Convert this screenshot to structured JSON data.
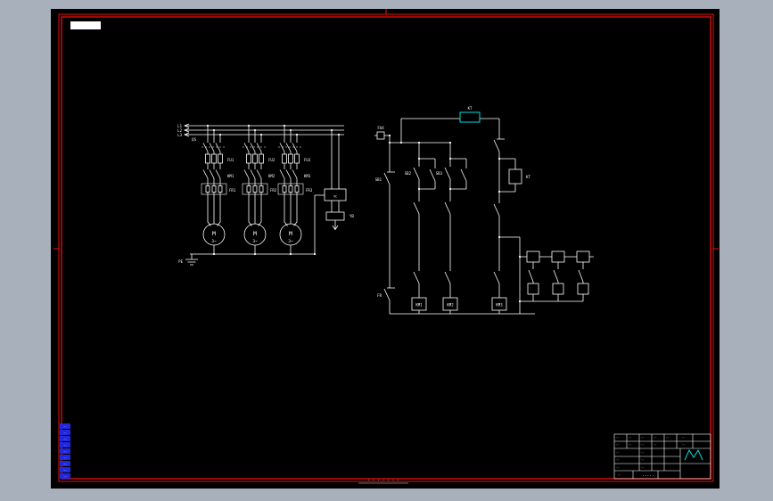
{
  "window": {
    "background": "#a7b0bb",
    "canvas": "#000000",
    "frame_color": "#e81010",
    "line_color": "#ffffff",
    "highlight_color": "#00dcdc",
    "margin_table_color": "#2228dd",
    "doc_text_color": "#5577ff"
  },
  "schematic": {
    "power": {
      "phase_labels": [
        "L1",
        "L2",
        "L3"
      ],
      "switch_label": "QS",
      "groups": [
        {
          "fuse": "FU1",
          "contactor": "KM1",
          "overload": "FR1",
          "motor": "M",
          "motor_type": "3~"
        },
        {
          "fuse": "FU2",
          "contactor": "KM2",
          "overload": "FR2",
          "motor": "M",
          "motor_type": "3~"
        },
        {
          "fuse": "FU3",
          "contactor": "KM3",
          "overload": "FR3",
          "motor": "M",
          "motor_type": "3~"
        }
      ],
      "ground_label": "PE",
      "rectifier_label": "VC",
      "brake_label": "YB"
    },
    "control": {
      "fuse_label": "FU4",
      "stop_label": "SB1",
      "start_labels": [
        "SB2",
        "SB3"
      ],
      "overload_label": "FR",
      "timer_label": "KT",
      "coil_labels": [
        "KM1",
        "KM2",
        "KM3"
      ]
    }
  },
  "margin_table": {
    "rows": [
      "··",
      "··",
      "··",
      "··",
      "··",
      "··",
      "··",
      "··",
      "··"
    ]
  },
  "title_block": {
    "cells": [
      "··",
      "··",
      "··",
      "··",
      "··",
      "··",
      "··",
      "··",
      "··",
      "··",
      "··",
      "··",
      "··",
      "··",
      "··",
      "··",
      "··",
      "··"
    ],
    "doc_no": "·····"
  },
  "caption": {
    "text": "· · · · · · ·"
  }
}
